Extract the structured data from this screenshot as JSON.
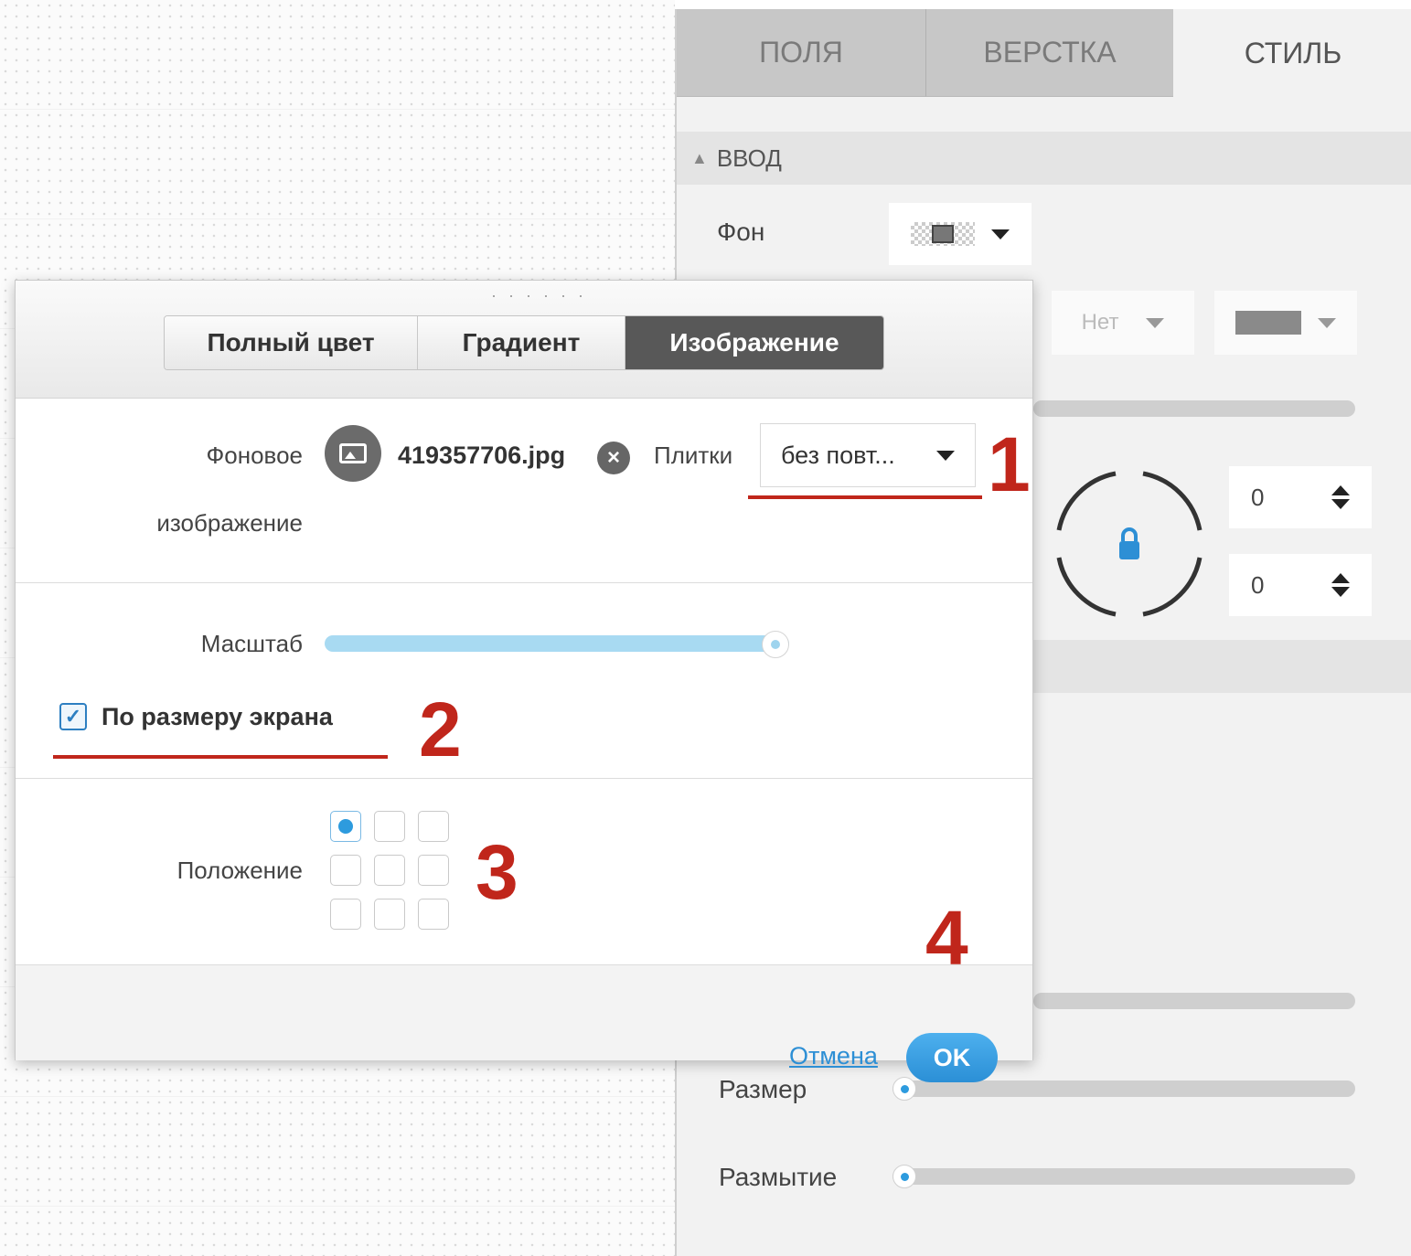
{
  "tabs": [
    "ПОЛЯ",
    "ВЕРСТКА",
    "СТИЛЬ"
  ],
  "section": {
    "title": "ВВОД"
  },
  "background": {
    "label": "Фон"
  },
  "ghost_select": {
    "value": "Нет"
  },
  "numbers": [
    "0",
    "0"
  ],
  "panel_labels": {
    "size": "Размер",
    "blur": "Размытие"
  },
  "dialog": {
    "grip": "· · · · · ·",
    "segments": [
      "Полный цвет",
      "Градиент",
      "Изображение"
    ],
    "bg_image_label_1": "Фоновое",
    "bg_image_label_2": "изображение",
    "file_name": "419357706.jpg",
    "tiles_label": "Плитки",
    "tiles_value": "без повт...",
    "scale_label": "Масштаб",
    "fit_screen_label": "По размеру экрана",
    "fit_screen_checked": true,
    "position_label": "Положение",
    "position_selected": "top-left",
    "cancel": "Отмена",
    "ok": "OK"
  },
  "annotations": [
    "1",
    "2",
    "3",
    "4"
  ],
  "colors": {
    "annotation": "#c0261b",
    "accent": "#2d9bde",
    "active_segment": "#585858"
  }
}
